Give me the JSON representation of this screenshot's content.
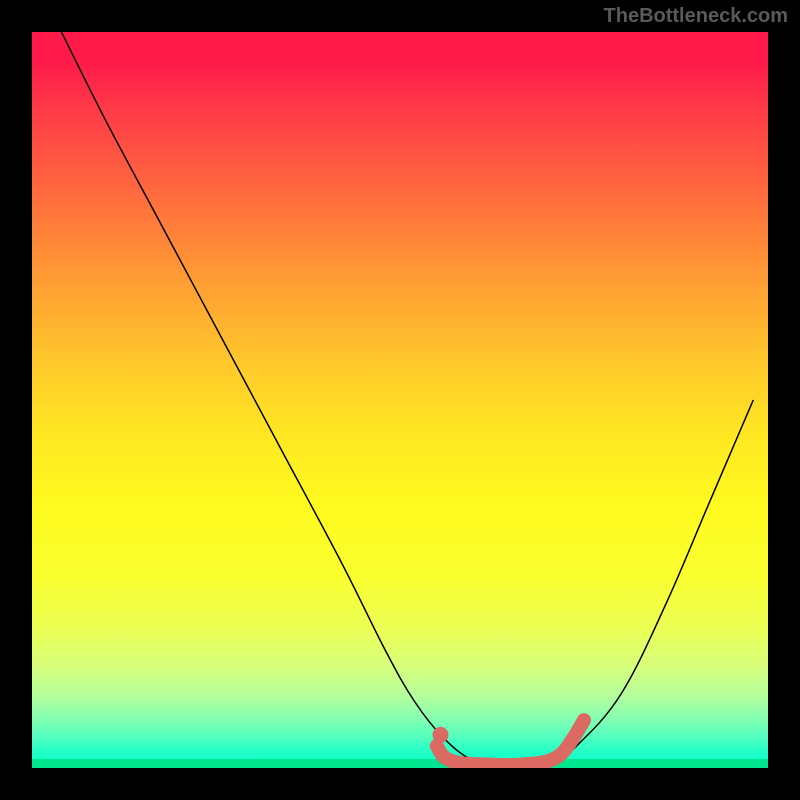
{
  "watermark": "TheBottleneck.com",
  "chart_data": {
    "type": "line",
    "title": "",
    "xlabel": "",
    "ylabel": "",
    "xlim": [
      0,
      100
    ],
    "ylim": [
      0,
      100
    ],
    "grid": false,
    "series": [
      {
        "name": "bottleneck-curve",
        "x": [
          4,
          10,
          18,
          26,
          34,
          42,
          48,
          52,
          56,
          60,
          64,
          68,
          71,
          74,
          80,
          86,
          92,
          98
        ],
        "y": [
          100,
          88,
          73,
          58,
          43,
          28,
          16,
          9,
          4,
          1,
          0.5,
          0.5,
          1,
          3,
          10,
          22,
          36,
          50
        ],
        "color": "#000000",
        "stroke_width": 1.5
      },
      {
        "name": "optimal-range",
        "x": [
          55,
          56,
          58,
          61,
          64,
          67,
          70,
          72,
          73.5,
          75
        ],
        "y": [
          3,
          1.5,
          0.7,
          0.5,
          0.4,
          0.5,
          0.9,
          2,
          4,
          6.5
        ],
        "color": "#db6a63",
        "stroke_width": 8
      },
      {
        "name": "optimal-marker",
        "x": [
          55.5
        ],
        "y": [
          4.5
        ],
        "color": "#db6a63",
        "type": "scatter"
      }
    ],
    "background_gradient": {
      "top": "#ff1a4a",
      "mid": "#ffe822",
      "bottom": "#00e58e"
    }
  }
}
